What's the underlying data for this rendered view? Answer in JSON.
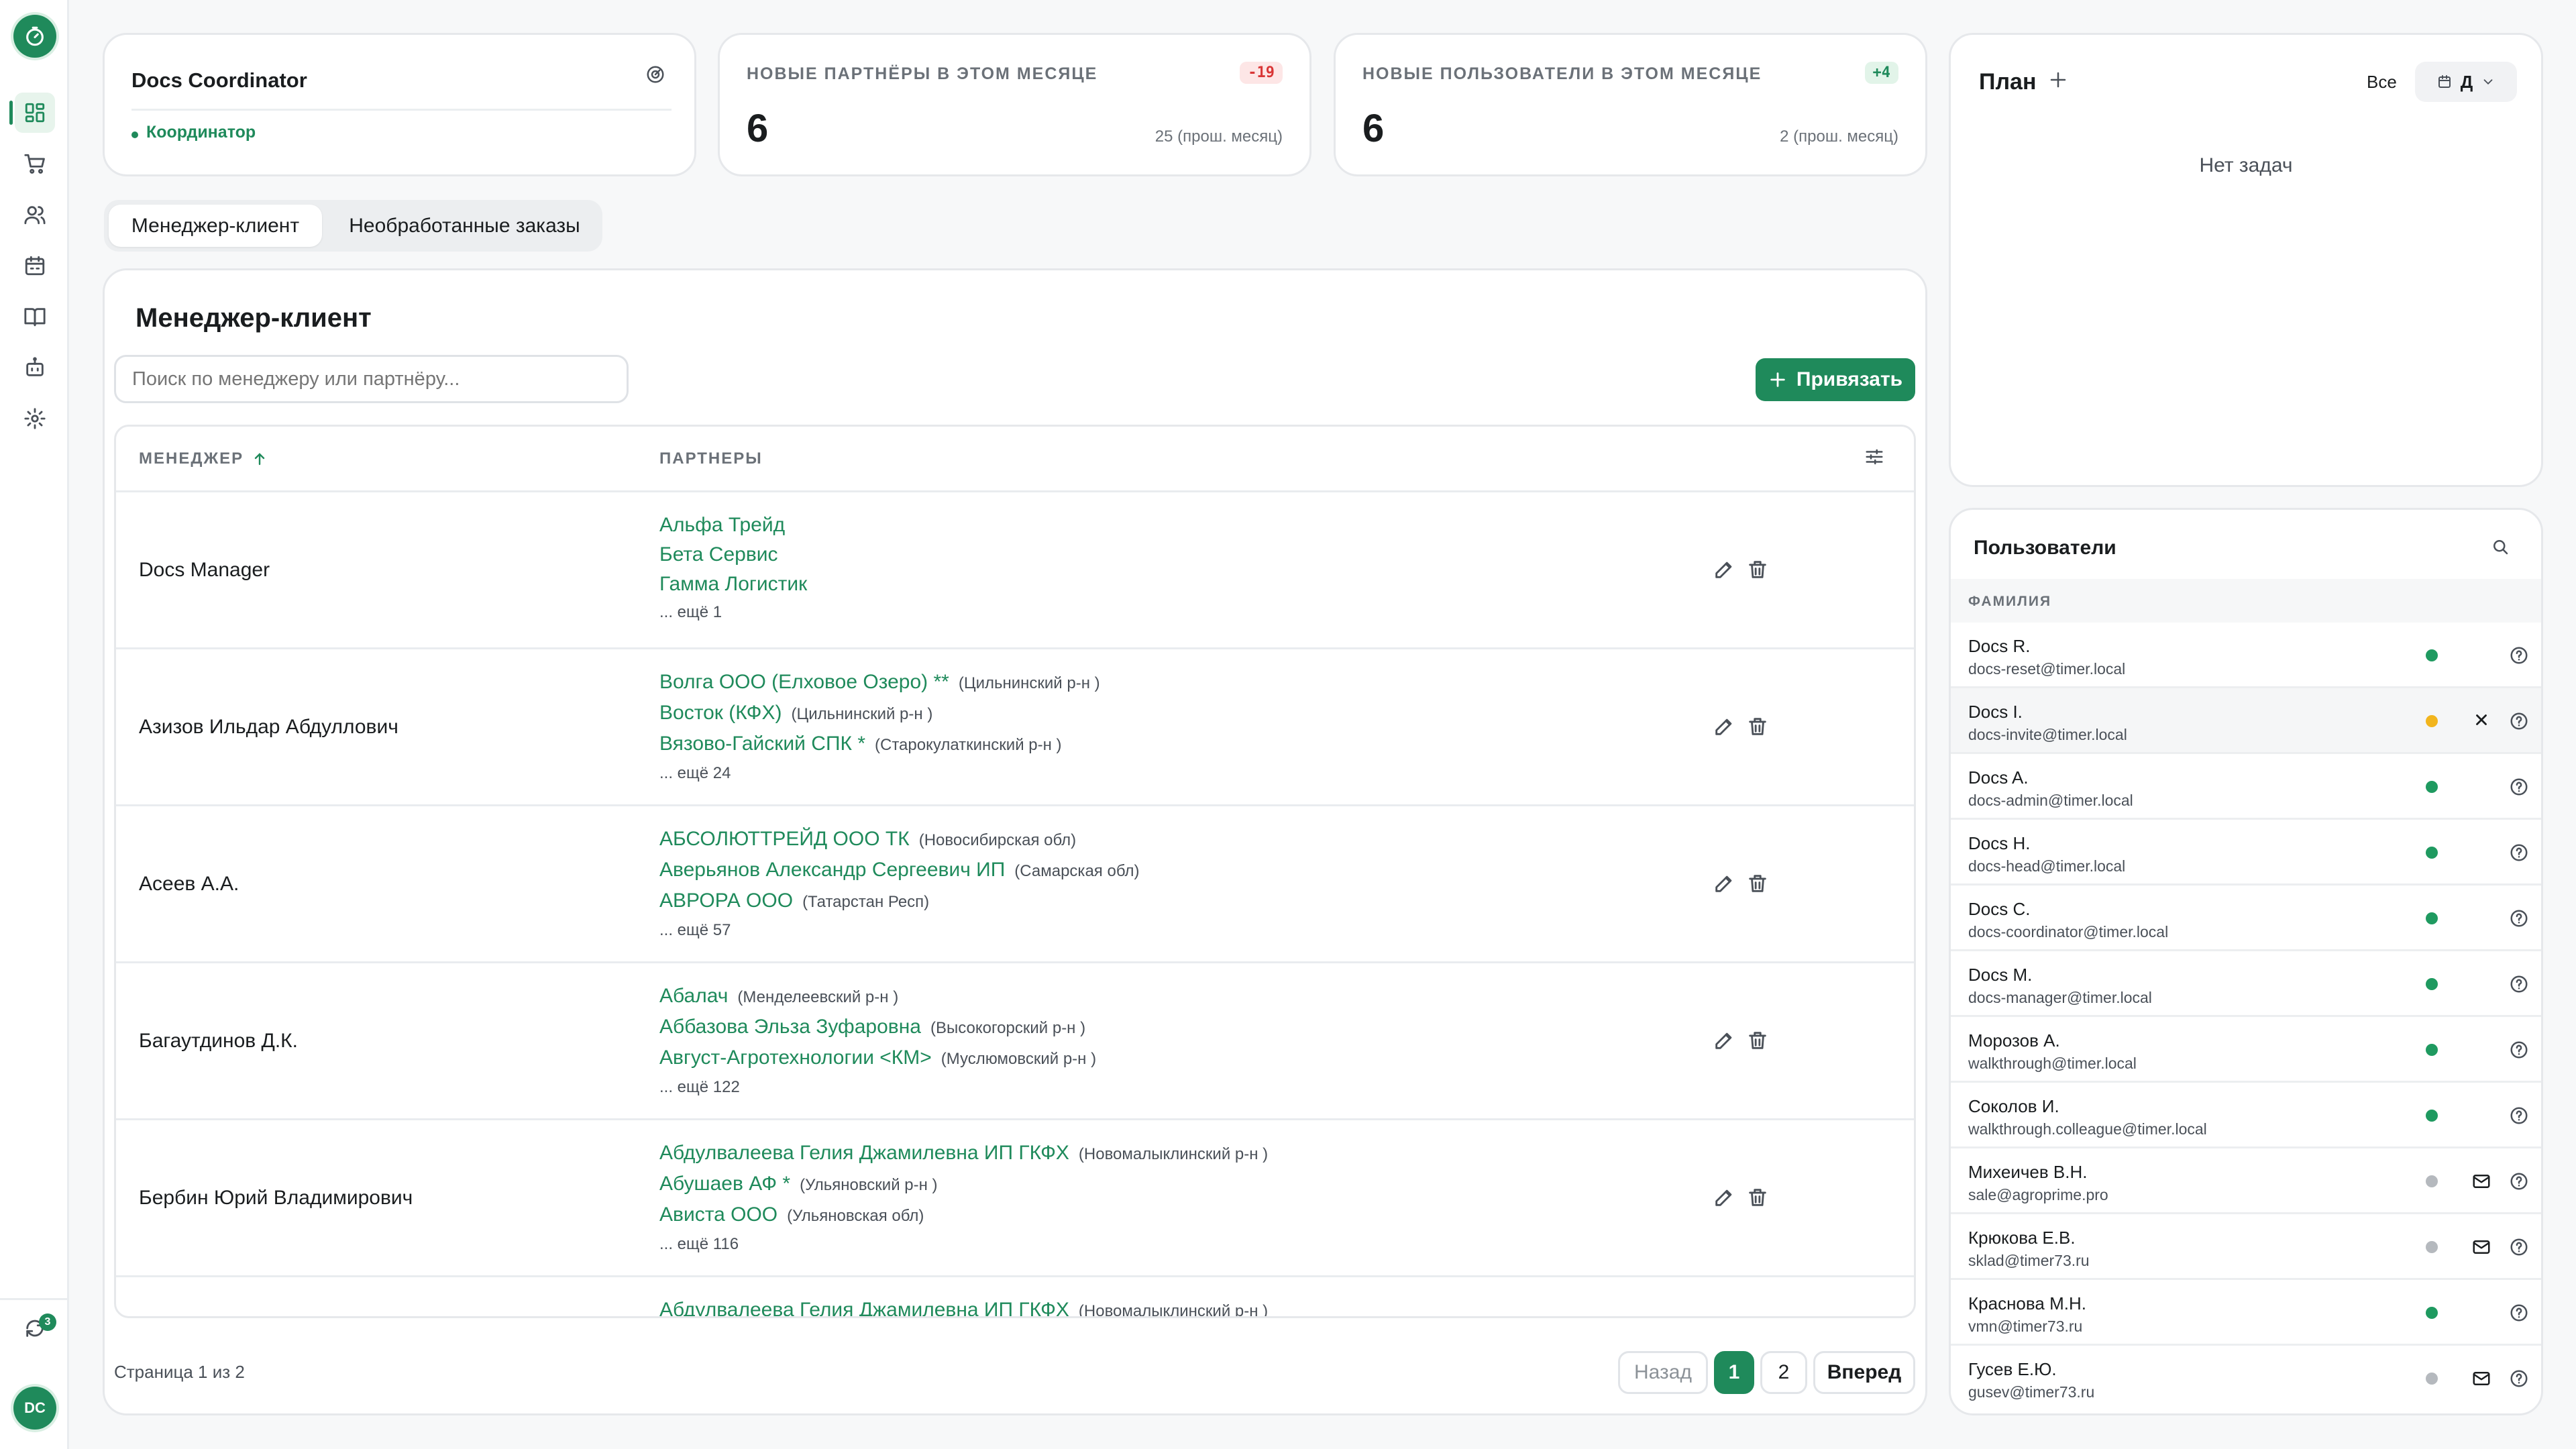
{
  "app": {
    "avatar_initials": "DC",
    "sync_count": "3"
  },
  "profile": {
    "name": "Docs Coordinator",
    "role": "Координатор"
  },
  "stats": [
    {
      "title": "Новые партнёры в этом месяце",
      "value": "6",
      "delta": "-19",
      "sub": "25 (прош. месяц)"
    },
    {
      "title": "Новые пользователи в этом месяце",
      "value": "6",
      "delta": "+4",
      "sub": "2 (прош. месяц)"
    }
  ],
  "tabs": [
    {
      "label": "Менеджер-клиент"
    },
    {
      "label": "Необработанные заказы"
    }
  ],
  "main": {
    "title": "Менеджер-клиент",
    "search_placeholder": "Поиск по менеджеру или партнёру...",
    "bind_button": "Привязать",
    "columns": {
      "manager": "МЕНЕДЖЕР",
      "partners": "ПАРТНЕРЫ"
    },
    "rows": [
      {
        "manager": "Docs Manager",
        "partners": [
          {
            "name": "Альфа Трейд",
            "region": ""
          },
          {
            "name": "Бета Сервис",
            "region": ""
          },
          {
            "name": "Гамма Логистик",
            "region": ""
          }
        ],
        "more": "... ещё 1"
      },
      {
        "manager": "Азизов Ильдар Абдуллович",
        "partners": [
          {
            "name": "Волга ООО (Елховое Озеро) **",
            "region": "(Цильнинский р-н )"
          },
          {
            "name": "Восток (КФХ)",
            "region": "(Цильнинский р-н )"
          },
          {
            "name": "Вязово-Гайский СПК *",
            "region": "(Старокулаткинский р-н )"
          }
        ],
        "more": "... ещё 24"
      },
      {
        "manager": "Асеев А.А.",
        "partners": [
          {
            "name": "АБСОЛЮТТРЕЙД ООО ТК",
            "region": "(Новосибирская обл)"
          },
          {
            "name": "Аверьянов Александр Сергеевич ИП",
            "region": "(Самарская обл)"
          },
          {
            "name": "АВРОРА ООО",
            "region": "(Татарстан Респ)"
          }
        ],
        "more": "... ещё 57"
      },
      {
        "manager": "Багаутдинов Д.К.",
        "partners": [
          {
            "name": "Абалач",
            "region": "(Менделеевский р-н )"
          },
          {
            "name": "Аббазова Эльза Зуфаровна",
            "region": "(Высокогорский р-н )"
          },
          {
            "name": "Август-Агротехнологии <КМ>",
            "region": "(Муслюмовский р-н )"
          }
        ],
        "more": "... ещё 122"
      },
      {
        "manager": "Бербин Юрий Владимирович",
        "partners": [
          {
            "name": "Абдулвалеева Гелия Джамилевна ИП ГКФХ",
            "region": "(Новомалыклинский р-н )"
          },
          {
            "name": "Абушаев АФ *",
            "region": "(Ульяновский р-н )"
          },
          {
            "name": "Ависта ООО",
            "region": "(Ульяновская обл)"
          }
        ],
        "more": "... ещё 116"
      },
      {
        "manager": "",
        "partners": [
          {
            "name": "Абдулвалеева Гелия Джамилевна ИП ГКФХ",
            "region": "(Новомалыклинский р-н )"
          }
        ],
        "more": ""
      }
    ],
    "pagination": {
      "info": "Страница 1 из 2",
      "prev": "Назад",
      "pages": [
        "1",
        "2"
      ],
      "next": "Вперед"
    }
  },
  "plan": {
    "title": "План",
    "filter": "Все",
    "view": "Д",
    "empty": "Нет задач"
  },
  "users": {
    "title": "Пользователи",
    "column": "ФАМИЛИЯ",
    "list": [
      {
        "name": "Docs R.",
        "email": "docs-reset@timer.local",
        "status": "active",
        "mail": false,
        "x": false
      },
      {
        "name": "Docs I.",
        "email": "docs-invite@timer.local",
        "status": "pending",
        "mail": false,
        "x": true
      },
      {
        "name": "Docs A.",
        "email": "docs-admin@timer.local",
        "status": "active",
        "mail": false,
        "x": false
      },
      {
        "name": "Docs H.",
        "email": "docs-head@timer.local",
        "status": "active",
        "mail": false,
        "x": false
      },
      {
        "name": "Docs C.",
        "email": "docs-coordinator@timer.local",
        "status": "active",
        "mail": false,
        "x": false
      },
      {
        "name": "Docs M.",
        "email": "docs-manager@timer.local",
        "status": "active",
        "mail": false,
        "x": false
      },
      {
        "name": "Морозов А.",
        "email": "walkthrough@timer.local",
        "status": "active",
        "mail": false,
        "x": false
      },
      {
        "name": "Соколов И.",
        "email": "walkthrough.colleague@timer.local",
        "status": "active",
        "mail": false,
        "x": false
      },
      {
        "name": "Михеичев В.Н.",
        "email": "sale@agroprime.pro",
        "status": "inactive",
        "mail": true,
        "x": false
      },
      {
        "name": "Крюкова Е.В.",
        "email": "sklad@timer73.ru",
        "status": "inactive",
        "mail": true,
        "x": false
      },
      {
        "name": "Краснова М.Н.",
        "email": "vmn@timer73.ru",
        "status": "active",
        "mail": false,
        "x": false
      },
      {
        "name": "Гусев Е.Ю.",
        "email": "gusev@timer73.ru",
        "status": "inactive",
        "mail": true,
        "x": false
      }
    ]
  },
  "colors": {
    "accent": "#1f8a5b",
    "active": "#1f9a60",
    "pending": "#f2b51d",
    "inactive": "#b5b9be",
    "danger": "#d93636"
  }
}
